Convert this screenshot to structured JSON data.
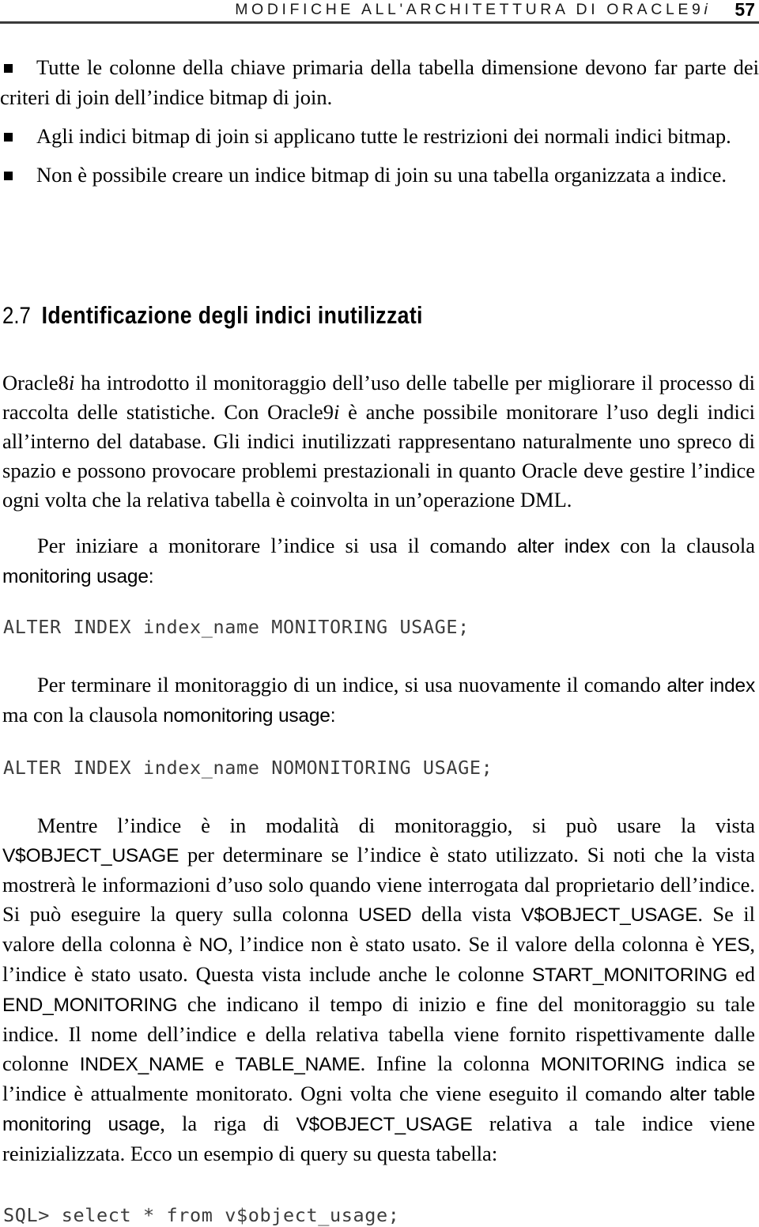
{
  "header": {
    "title_main": "MODIFICHE ALL'ARCHITETTURA DI ORACLE9",
    "title_suffix": "i",
    "page_number": "57"
  },
  "bullets": [
    {
      "text": "Tutte le colonne della chiave primaria della tabella dimensione devono far parte dei criteri di join dell’indice bitmap di join."
    },
    {
      "text": "Agli indici bitmap di join si applicano tutte le restrizioni dei normali indici bitmap."
    },
    {
      "text": "Non è possibile creare un indice bitmap di join su una tabella organizzata a indice."
    }
  ],
  "section": {
    "number": "2.7",
    "title": "Identificazione degli indici inutilizzati"
  },
  "paragraphs": {
    "oracle8i": {
      "p1": "Oracle8",
      "i1": "i",
      "p2": " ha introdotto il monitoraggio dell’uso delle tabelle per migliorare il processo di raccolta delle statistiche. Con Oracle9",
      "i2": "i",
      "p3": " è anche possibile monitorare l’uso degli indici all’interno del database. Gli indici inutilizzati rappresentano naturalmente uno spreco di spazio e possono provocare problemi prestazionali in quanto Oracle deve gestire l’indice ogni volta che la relativa tabella è coinvolta in un’operazione DML."
    },
    "per_iniziare": {
      "p1": "Per iniziare a monitorare l’indice si usa il comando ",
      "code1": "alter index",
      "p2": " con la clausola ",
      "code2": "monitoring usage",
      "p3": ":"
    },
    "per_terminare": {
      "p1": "Per terminare il monitoraggio di un indice, si usa nuovamente il comando ",
      "code1": "alter index",
      "p2": " ma con la clausola ",
      "code2": "nomonitoring usage",
      "p3": ":"
    },
    "mentre": {
      "s1": "Mentre l’indice è in modalità di monitoraggio, si può usare la vista ",
      "c1": "V$OBJECT_USAGE",
      "s2": " per determinare se l’indice è stato utilizzato. Si noti che la vista mostrerà le informazioni d’uso solo quando viene interrogata dal proprietario dell’indice. Si può eseguire la query sulla colonna ",
      "c2": "USED",
      "s3": " della vista ",
      "c3": "V$OBJECT_USAGE",
      "s4": ". Se il valore della colonna è ",
      "c4": "NO",
      "s5": ", l’indice non è stato usato. Se il valore della colonna è ",
      "c5": "YES",
      "s6": ", l’indice è stato usato. Questa vista include anche le colonne ",
      "c6": "START_MONITORING",
      "s7": " ed ",
      "c7": "END_MONITORING",
      "s8": " che indicano il tempo di inizio e fine del monitoraggio su tale indice. Il nome dell’indice e della relativa tabella viene fornito rispettivamente dalle colonne ",
      "c8": "INDEX_NAME",
      "s9": " e ",
      "c9": "TABLE_NAME",
      "s10": ". Infine la colonna ",
      "c10": "MONITORING",
      "s11": " indica se l’indice è attualmente monitorato. Ogni volta che viene eseguito il comando ",
      "c11": "alter table monitoring usage",
      "s12": ", la riga di ",
      "c12": "V$OBJECT_USAGE",
      "s13": " relativa a tale indice viene reinizializzata. Ecco un esempio di query su questa tabella:"
    }
  },
  "code_blocks": {
    "monitoring": "ALTER INDEX index_name MONITORING USAGE;",
    "nomonitoring": "ALTER INDEX index_name NOMONITORING USAGE;",
    "sql_query": "SQL> select * from v$object_usage;"
  },
  "colors": {
    "text": "#000000",
    "rule": "#3a3a3a",
    "code": "#3c3c3c"
  }
}
